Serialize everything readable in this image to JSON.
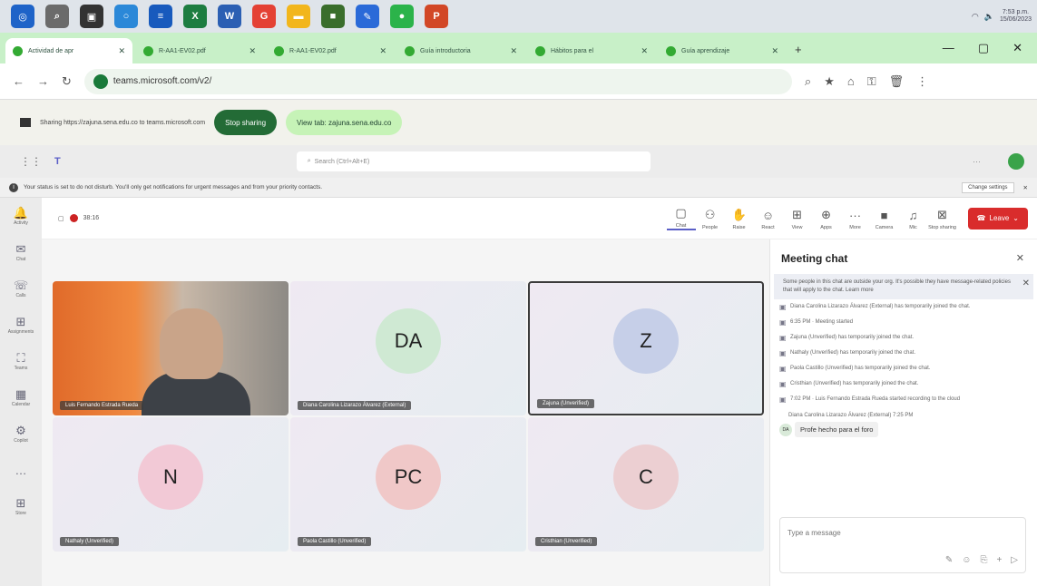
{
  "taskbar": {
    "clock_time": "7:53 p.m.",
    "clock_date": "15/06/2023",
    "apps": [
      {
        "color": "#1e63c8",
        "glyph": "◎"
      },
      {
        "color": "#6b6b6b",
        "glyph": "⌕"
      },
      {
        "color": "#333",
        "glyph": "▣"
      },
      {
        "color": "#2b88d8",
        "glyph": "○"
      },
      {
        "color": "#185abd",
        "glyph": "≡"
      },
      {
        "color": "#1d7d41",
        "glyph": "X"
      },
      {
        "color": "#2b5fb3",
        "glyph": "W"
      },
      {
        "color": "#e44134",
        "glyph": "G"
      },
      {
        "color": "#f2b61c",
        "glyph": "▬"
      },
      {
        "color": "#3a6e2c",
        "glyph": "■"
      },
      {
        "color": "#2a6ad8",
        "glyph": "✎"
      },
      {
        "color": "#2bb34a",
        "glyph": "●"
      },
      {
        "color": "#d24726",
        "glyph": "P"
      }
    ]
  },
  "tabs": [
    {
      "label": "Actividad de apr",
      "active": true
    },
    {
      "label": "R-AA1-EV02.pdf"
    },
    {
      "label": "R-AA1-EV02.pdf"
    },
    {
      "label": "Guía introductoria"
    },
    {
      "label": "Hábitos para el"
    },
    {
      "label": "Guía aprendizaje"
    }
  ],
  "address": {
    "url": "teams.microsoft.com/v2/"
  },
  "sharing": {
    "text": "Sharing https://zajuna.sena.edu.co to teams.microsoft.com",
    "stop": "Stop sharing",
    "view": "View tab: zajuna.sena.edu.co"
  },
  "teams": {
    "search_placeholder": "Search (Ctrl+Alt+E)"
  },
  "status": {
    "text": "Your status is set to do not disturb. You'll only get notifications for urgent messages and from your priority contacts.",
    "change": "Change settings"
  },
  "rail": [
    {
      "label": "Activity",
      "glyph": "🔔"
    },
    {
      "label": "Chat",
      "glyph": "✉"
    },
    {
      "label": "Calls",
      "glyph": "☏"
    },
    {
      "label": "Assignments",
      "glyph": "⊞"
    },
    {
      "label": "Teams",
      "glyph": "⛶"
    },
    {
      "label": "Calendar",
      "glyph": "▦"
    },
    {
      "label": "Copilot",
      "glyph": "⚙"
    },
    {
      "label": "",
      "glyph": "…"
    },
    {
      "label": "Store",
      "glyph": "⊞"
    }
  ],
  "call": {
    "timer": "38:16",
    "leave": "Leave",
    "tools": [
      {
        "label": "Chat",
        "glyph": "▢"
      },
      {
        "label": "People",
        "glyph": "⚇"
      },
      {
        "label": "Raise",
        "glyph": "✋"
      },
      {
        "label": "React",
        "glyph": "☺"
      },
      {
        "label": "View",
        "glyph": "⊞"
      },
      {
        "label": "Apps",
        "glyph": "⊕"
      },
      {
        "label": "More",
        "glyph": "···"
      },
      {
        "label": "Camera",
        "glyph": "■"
      },
      {
        "label": "Mic",
        "glyph": "♫"
      },
      {
        "label": "Stop sharing",
        "glyph": "⊠"
      }
    ]
  },
  "participants": [
    {
      "name": "Luis Fernando Estrada Rueda",
      "initials": "",
      "video": true
    },
    {
      "name": "Diana Carolina Lizarazo Álvarez (External)",
      "initials": "DA",
      "color": "#cfe9d3"
    },
    {
      "name": "Zajuna (Unverified)",
      "initials": "Z",
      "color": "#c6cfe8",
      "selected": true
    },
    {
      "name": "Nathaly (Unverified)",
      "initials": "N",
      "color": "#f2c9d6"
    },
    {
      "name": "Paola Castillo (Unverified)",
      "initials": "PC",
      "color": "#f0c8c8"
    },
    {
      "name": "Cristhian (Unverified)",
      "initials": "C",
      "color": "#eccfd2"
    }
  ],
  "chat": {
    "title": "Meeting chat",
    "banner": "Some people in this chat are outside your org. It's possible they have message-related policies that will apply to the chat. Learn more",
    "events": [
      "Diana Carolina Lizarazo Álvarez (External) has temporarily joined the chat.",
      "6:35 PM · Meeting started",
      "Zajuna (Unverified) has temporarily joined the chat.",
      "Nathaly (Unverified) has temporarily joined the chat.",
      "Paola Castillo (Unverified) has temporarily joined the chat.",
      "Cristhian (Unverified) has temporarily joined the chat.",
      "7:02 PM · Luis Fernando Estrada Rueda started recording to the cloud"
    ],
    "sender": "Diana Carolina Lizarazo Álvarez (External) 7:25 PM",
    "sender_initials": "DA",
    "message": "Profe hecho para el foro",
    "compose_placeholder": "Type a message"
  }
}
